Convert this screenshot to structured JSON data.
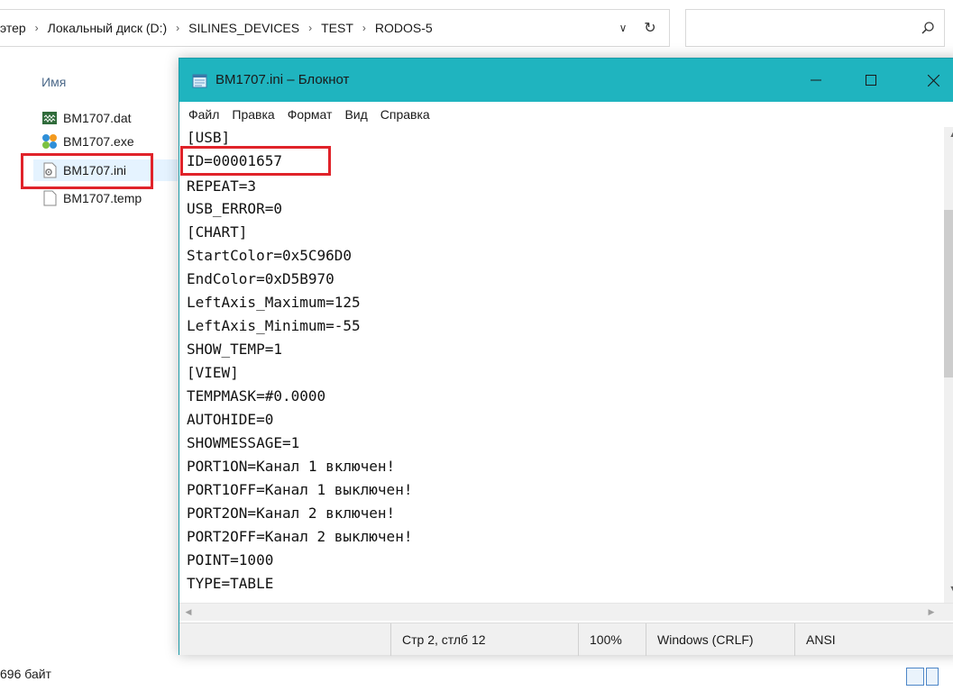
{
  "explorer": {
    "breadcrumb": [
      "этер",
      "Локальный диск (D:)",
      "SILINES_DEVICES",
      "TEST",
      "RODOS-5"
    ],
    "column_name": "Имя",
    "files": [
      {
        "name": "BM1707.dat",
        "icon": "dat-file-icon"
      },
      {
        "name": "BM1707.exe",
        "icon": "exe-app-icon"
      },
      {
        "name": "BM1707.ini",
        "icon": "ini-settings-icon"
      },
      {
        "name": "BM1707.temp",
        "icon": "blank-file-icon"
      }
    ],
    "status_size": "696 байт"
  },
  "notepad": {
    "title": "BM1707.ini – Блокнот",
    "menu": [
      "Файл",
      "Правка",
      "Формат",
      "Вид",
      "Справка"
    ],
    "lines": [
      "[USB]",
      "ID=00001657",
      "REPEAT=3",
      "USB_ERROR=0",
      "[CHART]",
      "StartColor=0x5C96D0",
      "EndColor=0xD5B970",
      "LeftAxis_Maximum=125",
      "LeftAxis_Minimum=-55",
      "SHOW_TEMP=1",
      "[VIEW]",
      "TEMPMASK=#0.0000",
      "AUTOHIDE=0",
      "SHOWMESSAGE=1",
      "PORT1ON=Канал 1 включен!",
      "PORT1OFF=Канал 1 выключен!",
      "PORT2ON=Канал 2 включен!",
      "PORT2OFF=Канал 2 выключен!",
      "POINT=1000",
      "TYPE=TABLE"
    ],
    "status": {
      "position": "Стр 2, стлб 12",
      "zoom": "100%",
      "line_ending": "Windows (CRLF)",
      "encoding": "ANSI"
    }
  },
  "colors": {
    "titlebar": "#1fb4bf",
    "highlight_red": "#e0232a"
  }
}
